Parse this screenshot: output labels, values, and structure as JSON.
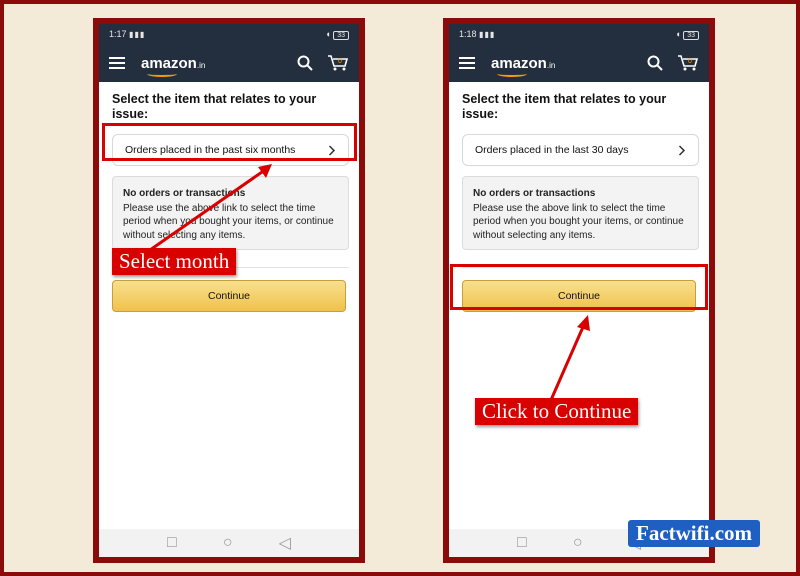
{
  "status_bar": {
    "left_time": "1:17",
    "right_time": "1:18",
    "battery": "33"
  },
  "app": {
    "logo_text": "amazon",
    "logo_tld": ".in",
    "brand_color": "#ff9900",
    "nav_bg": "#232f3e"
  },
  "prompt": "Select the item that relates to your issue:",
  "left_screen": {
    "period_option": "Orders placed in the past six months"
  },
  "right_screen": {
    "period_option": "Orders placed in the last 30 days"
  },
  "info_box": {
    "title": "No orders or transactions",
    "body": "Please use the above link to select the time period when you bought your items, or continue without selecting any items."
  },
  "continue_label": "Continue",
  "annotations": {
    "select_month": "Select month",
    "click_continue": "Click to Continue",
    "highlight_color": "#d90000"
  },
  "watermark": "Factwifi.com"
}
